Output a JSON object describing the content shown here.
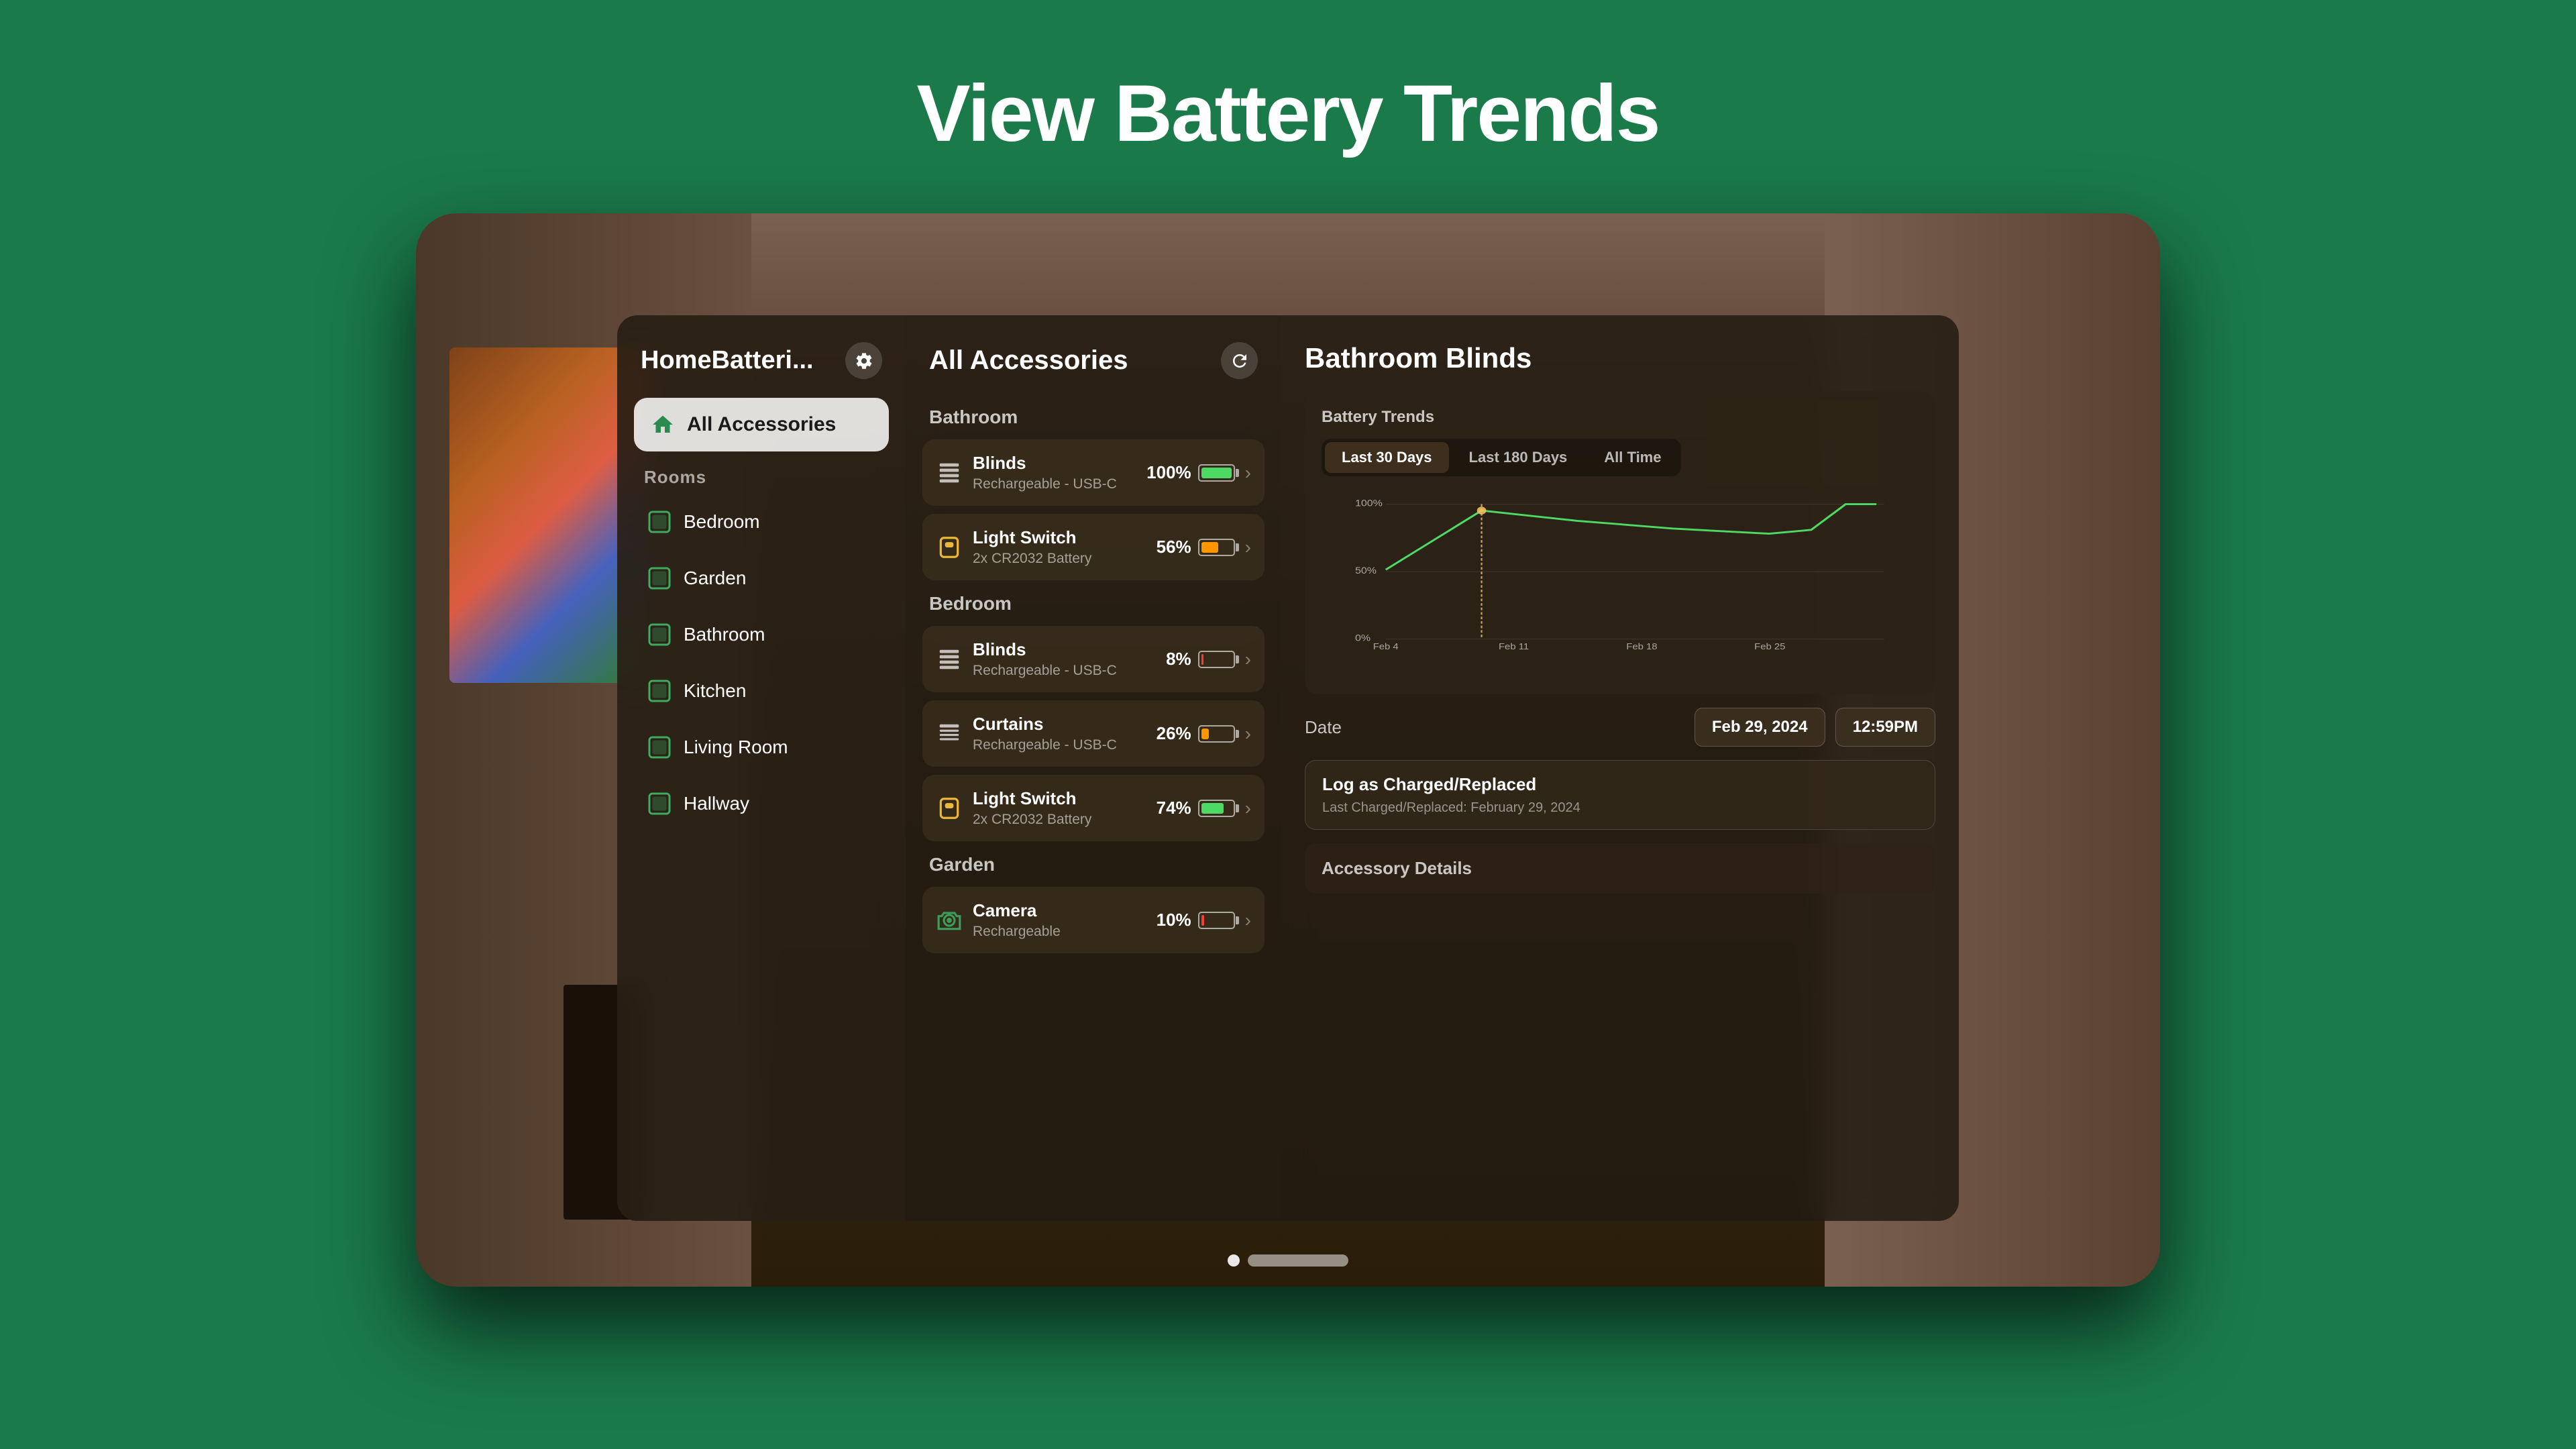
{
  "page": {
    "title": "View Battery Trends",
    "background_color": "#1a7a4a"
  },
  "sidebar": {
    "title": "HomeBatteri...",
    "all_accessories_label": "All Accessories",
    "rooms_label": "Rooms",
    "rooms": [
      {
        "label": "Bedroom",
        "icon": "bedroom-icon"
      },
      {
        "label": "Garden",
        "icon": "garden-icon"
      },
      {
        "label": "Bathroom",
        "icon": "bathroom-icon"
      },
      {
        "label": "Kitchen",
        "icon": "kitchen-icon"
      },
      {
        "label": "Living Room",
        "icon": "living-room-icon"
      },
      {
        "label": "Hallway",
        "icon": "hallway-icon"
      }
    ]
  },
  "accessories_panel": {
    "title": "All Accessories",
    "sections": [
      {
        "label": "Bathroom",
        "items": [
          {
            "name": "Blinds",
            "type": "Rechargeable - USB-C",
            "battery_pct": "100%",
            "battery_level": 100,
            "battery_status": "green"
          },
          {
            "name": "Light Switch",
            "type": "2x CR2032 Battery",
            "battery_pct": "56%",
            "battery_level": 56,
            "battery_status": "orange"
          }
        ]
      },
      {
        "label": "Bedroom",
        "items": [
          {
            "name": "Blinds",
            "type": "Rechargeable - USB-C",
            "battery_pct": "8%",
            "battery_level": 8,
            "battery_status": "red"
          },
          {
            "name": "Curtains",
            "type": "Rechargeable - USB-C",
            "battery_pct": "26%",
            "battery_level": 26,
            "battery_status": "orange"
          },
          {
            "name": "Light Switch",
            "type": "2x CR2032 Battery",
            "battery_pct": "74%",
            "battery_level": 74,
            "battery_status": "green"
          }
        ]
      },
      {
        "label": "Garden",
        "items": [
          {
            "name": "Camera",
            "type": "Rechargeable",
            "battery_pct": "10%",
            "battery_level": 10,
            "battery_status": "red"
          }
        ]
      }
    ]
  },
  "detail_panel": {
    "title": "Bathroom Blinds",
    "battery_trends_label": "Battery Trends",
    "time_tabs": [
      "Last 30 Days",
      "Last 180 Days",
      "All Time"
    ],
    "active_tab": "Last 30 Days",
    "chart": {
      "x_labels": [
        "Feb 4",
        "Feb 11",
        "Feb 18",
        "Feb 25"
      ],
      "y_labels": [
        "100%",
        "50%",
        "0%"
      ],
      "data_points": [
        {
          "x": 0.0,
          "y": 0.55
        },
        {
          "x": 0.18,
          "y": 0.95
        },
        {
          "x": 0.35,
          "y": 0.88
        },
        {
          "x": 0.55,
          "y": 0.83
        },
        {
          "x": 0.75,
          "y": 0.8
        },
        {
          "x": 0.85,
          "y": 0.82
        },
        {
          "x": 0.92,
          "y": 1.0
        },
        {
          "x": 1.0,
          "y": 1.0
        }
      ],
      "highlight_x": 0.18,
      "highlight_y": 0.95
    },
    "date_label": "Date",
    "date_value": "Feb 29, 2024",
    "time_value": "12:59PM",
    "log_button_label": "Log as Charged/Replaced",
    "last_charged_label": "Last Charged/Replaced: February 29, 2024",
    "accessory_details_label": "Accessory Details"
  }
}
